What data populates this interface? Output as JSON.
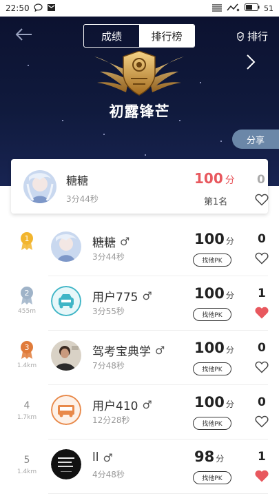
{
  "status_bar": {
    "time": "22:50",
    "battery": "51"
  },
  "header": {
    "tabs": [
      {
        "label": "成绩",
        "active": false
      },
      {
        "label": "排行榜",
        "active": true
      }
    ],
    "rank_button_label": "排行",
    "title": "初露锋芒",
    "share_label": "分享"
  },
  "my_entry": {
    "name": "糖糖",
    "time": "3分44秒",
    "score": "100",
    "score_unit": "分",
    "rank": "第1名",
    "likes": "0",
    "liked": false
  },
  "leaderboard": [
    {
      "rank": "1",
      "medal": "gold",
      "distance": "",
      "name": "糖糖",
      "gender": "♂",
      "time": "3分44秒",
      "score": "100",
      "unit": "分",
      "pk_label": "找他PK",
      "likes": "0",
      "liked": false,
      "avatar": "anime"
    },
    {
      "rank": "2",
      "medal": "silver",
      "distance": "455m",
      "name": "用户775",
      "gender": "♂",
      "time": "3分55秒",
      "score": "100",
      "unit": "分",
      "pk_label": "找他PK",
      "likes": "1",
      "liked": true,
      "avatar": "car"
    },
    {
      "rank": "3",
      "medal": "bronze",
      "distance": "1.4km",
      "name": "驾考宝典学",
      "gender": "♂",
      "time": "7分48秒",
      "score": "100",
      "unit": "分",
      "pk_label": "找他PK",
      "likes": "0",
      "liked": false,
      "avatar": "photo"
    },
    {
      "rank": "4",
      "medal": "",
      "distance": "1.7km",
      "name": "用户410",
      "gender": "♂",
      "time": "12分28秒",
      "score": "100",
      "unit": "分",
      "pk_label": "找他PK",
      "likes": "0",
      "liked": false,
      "avatar": "truck"
    },
    {
      "rank": "5",
      "medal": "",
      "distance": "1.4km",
      "name": "ll",
      "gender": "♂",
      "time": "4分48秒",
      "score": "98",
      "unit": "分",
      "pk_label": "找他PK",
      "likes": "1",
      "liked": true,
      "avatar": "dark"
    }
  ],
  "colors": {
    "accent_red": "#e8585e",
    "hero_bg": "#101a3d",
    "share_bg": "#6b87a8",
    "gold": "#f2b52e",
    "silver": "#9fb3c8",
    "bronze": "#e07b3a",
    "car_teal": "#3fb5c6",
    "truck_orange": "#e8894a"
  },
  "icons": {
    "back": "arrow-left-icon",
    "rank": "rank-icon",
    "next": "chevron-right-icon",
    "heart": "heart-icon",
    "gender": "male-icon"
  }
}
